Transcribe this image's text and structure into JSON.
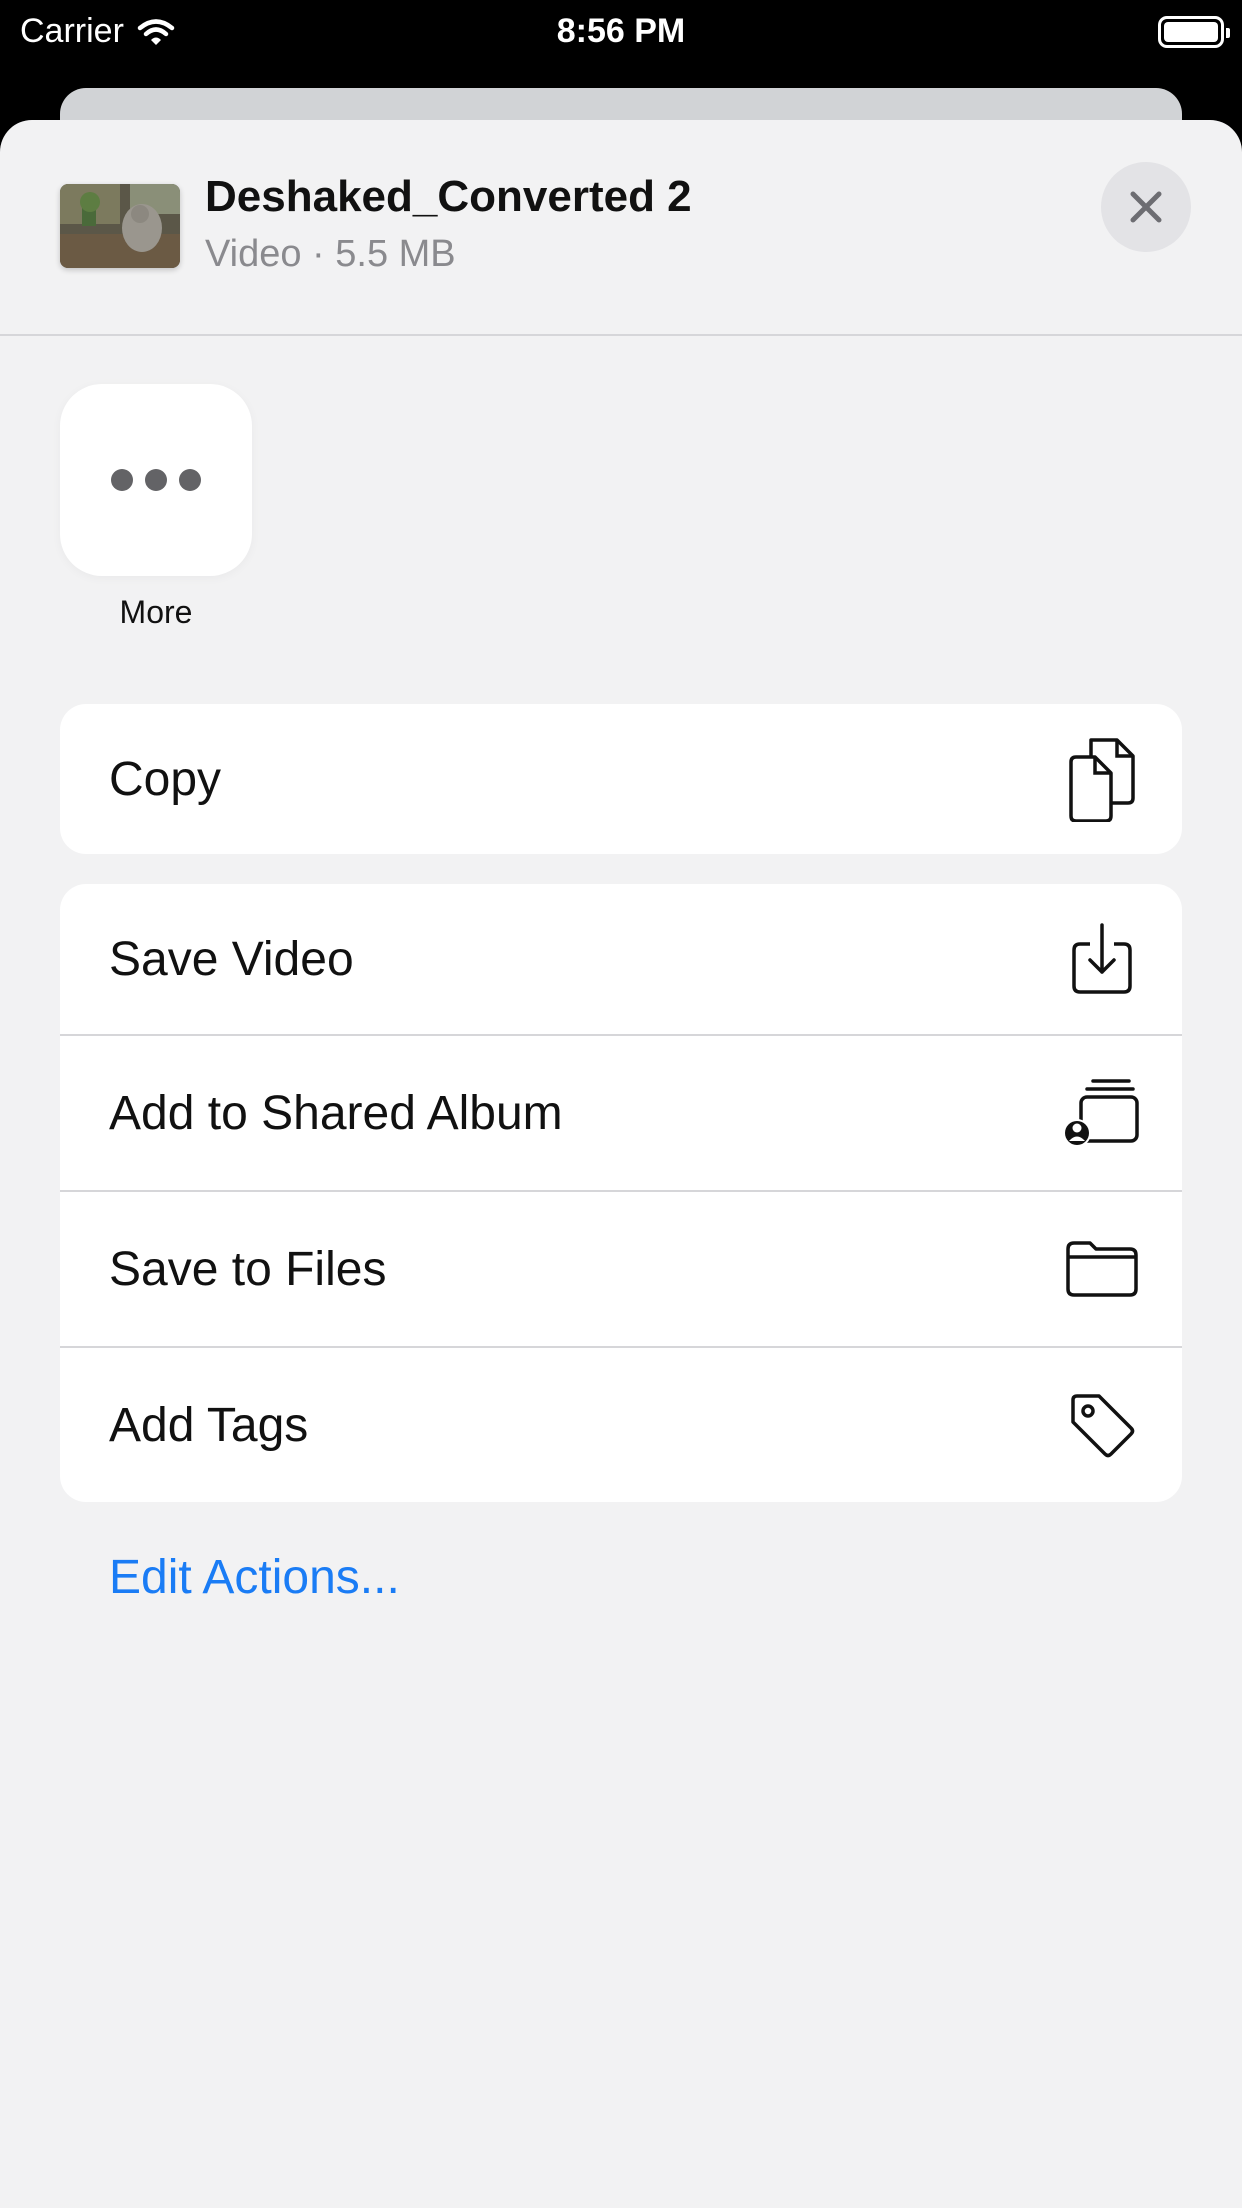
{
  "status_bar": {
    "carrier": "Carrier",
    "time": "8:56 PM"
  },
  "share_sheet": {
    "file": {
      "name": "Deshaked_Converted 2",
      "details": "Video · 5.5 MB",
      "thumbnail": "video-thumbnail"
    },
    "apps": [
      {
        "label": "More",
        "icon": "ellipsis-icon"
      }
    ],
    "action_groups": [
      [
        {
          "label": "Copy",
          "icon": "copy-icon"
        }
      ],
      [
        {
          "label": "Save Video",
          "icon": "download-icon"
        },
        {
          "label": "Add to Shared Album",
          "icon": "shared-album-icon"
        },
        {
          "label": "Save to Files",
          "icon": "folder-icon"
        },
        {
          "label": "Add Tags",
          "icon": "tag-icon"
        }
      ]
    ],
    "edit_actions_label": "Edit Actions..."
  },
  "colors": {
    "accent": "#1a7cf5",
    "sheet_background": "#f2f2f3",
    "card_background": "#ffffff",
    "secondary_text": "#8a8a8e"
  }
}
